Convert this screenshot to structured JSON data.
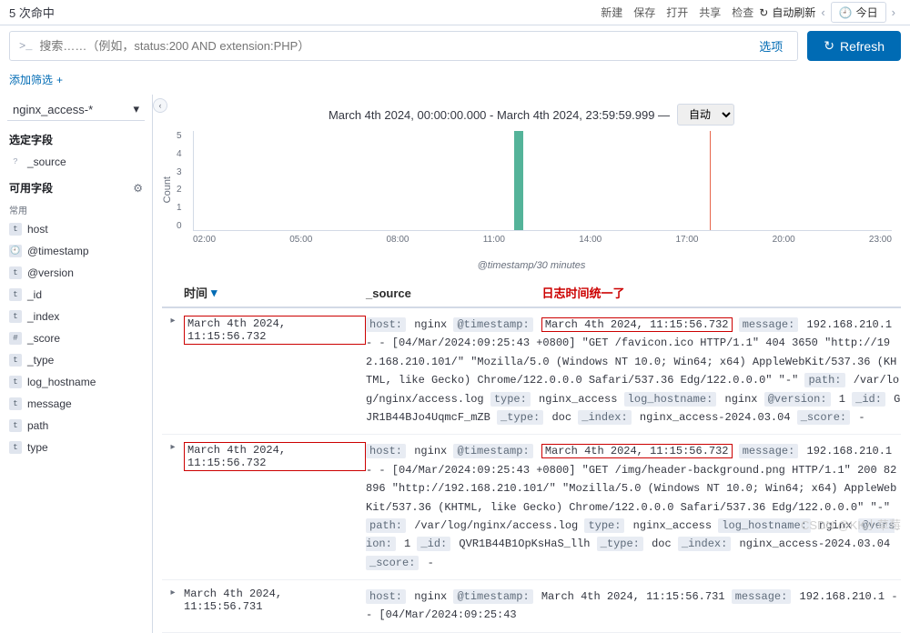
{
  "topbar": {
    "hits_prefix": "5",
    "hits_suffix": "次命中",
    "new": "新建",
    "save": "保存",
    "open": "打开",
    "share": "共享",
    "inspect": "检查",
    "auto_refresh": "自动刷新",
    "today": "今日"
  },
  "search": {
    "prompt": ">_",
    "placeholder": "搜索……（例如，status:200 AND extension:PHP）",
    "options": "选项",
    "refresh": "Refresh"
  },
  "filter": {
    "add": "添加筛选"
  },
  "sidebar": {
    "index_pattern": "nginx_access-*",
    "selected_title": "选定字段",
    "source_field": "_source",
    "available_title": "可用字段",
    "popular_label": "常用",
    "fields": {
      "host": "host",
      "timestamp": "@timestamp",
      "version": "@version",
      "id": "_id",
      "index": "_index",
      "score": "_score",
      "type": "_type",
      "log_hostname": "log_hostname",
      "message": "message",
      "path": "path",
      "type2": "type"
    }
  },
  "timerange": {
    "label": "March 4th 2024, 00:00:00.000 - March 4th 2024, 23:59:59.999 —",
    "interval": "自动"
  },
  "chart_data": {
    "type": "bar",
    "ylabel": "Count",
    "xlabel": "@timestamp/30 minutes",
    "y_ticks": [
      "5",
      "4",
      "3",
      "2",
      "1",
      "0"
    ],
    "x_ticks": [
      "02:00",
      "05:00",
      "08:00",
      "11:00",
      "14:00",
      "17:00",
      "20:00",
      "23:00"
    ],
    "bars": [
      {
        "time": "11:00",
        "value": 5
      }
    ],
    "now_marker": "17:45"
  },
  "table": {
    "time_header": "时间",
    "source_header": "_source",
    "annotation": "日志时间统一了",
    "rows": [
      {
        "time": "March 4th 2024, 11:15:56.732",
        "time_boxed": true,
        "ts": "March 4th 2024, 11:15:56.732",
        "ts_boxed": true,
        "host": "nginx",
        "message": "192.168.210.1 - - [04/Mar/2024:09:25:43 +0800] \"GET /favicon.ico HTTP/1.1\" 404 3650 \"http://192.168.210.101/\" \"Mozilla/5.0 (Windows NT 10.0; Win64; x64) AppleWebKit/537.36 (KHTML, like Gecko) Chrome/122.0.0.0 Safari/537.36 Edg/122.0.0.0\" \"-\"",
        "path": "/var/log/nginx/access.log",
        "type": "nginx_access",
        "log_hostname": "nginx",
        "version": "1",
        "id": "GJR1B44BJo4UqmcF_mZB",
        "doctype": "doc",
        "index": "nginx_access-2024.03.04",
        "score": "-"
      },
      {
        "time": "March 4th 2024, 11:15:56.732",
        "time_boxed": true,
        "ts": "March 4th 2024, 11:15:56.732",
        "ts_boxed": true,
        "host": "nginx",
        "message": "192.168.210.1 - - [04/Mar/2024:09:25:43 +0800] \"GET /img/header-background.png HTTP/1.1\" 200 82896 \"http://192.168.210.101/\" \"Mozilla/5.0 (Windows NT 10.0; Win64; x64) AppleWebKit/537.36 (KHTML, like Gecko) Chrome/122.0.0.0 Safari/537.36 Edg/122.0.0.0\" \"-\"",
        "path": "/var/log/nginx/access.log",
        "type": "nginx_access",
        "log_hostname": "nginx",
        "version": "1",
        "id": "QVR1B44B1OpKsHaS_llh",
        "doctype": "doc",
        "index": "nginx_access-2024.03.04",
        "score": "-"
      },
      {
        "time": "March 4th 2024, 11:15:56.731",
        "time_boxed": false,
        "ts": "March 4th 2024, 11:15:56.731",
        "ts_boxed": false,
        "host": "nginx",
        "message": "192.168.210.1 - - [04/Mar/2024:09:25:43",
        "trunc": true
      }
    ]
  },
  "watermark": "CSDN @KK小草莓"
}
